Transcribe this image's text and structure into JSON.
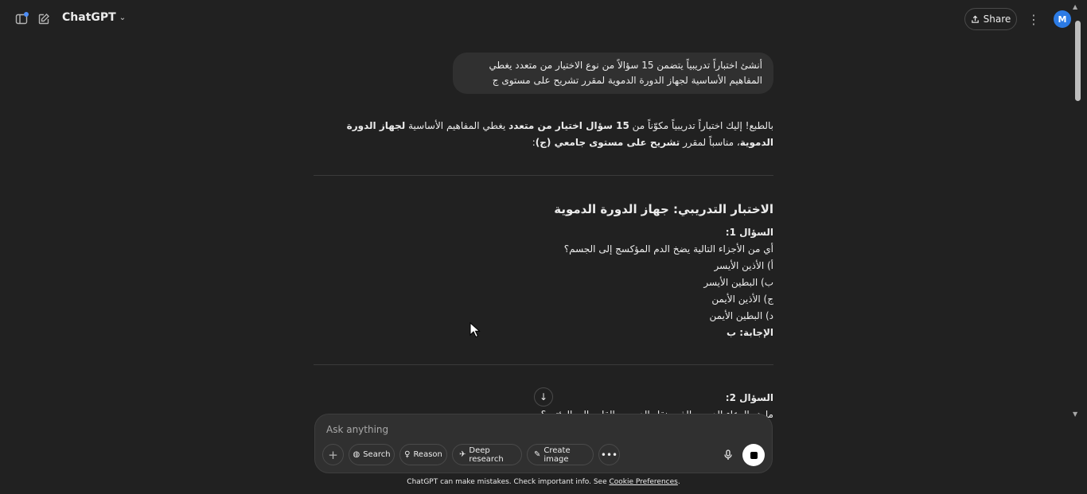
{
  "header": {
    "model_name": "ChatGPT",
    "share_label": "Share",
    "avatar_initial": "M",
    "accent_color": "#2c7be5"
  },
  "conversation": {
    "user_message": "أنشئ اختباراً تدريبياً يتضمن 15 سؤالاً من نوع الاختيار من متعدد يغطي المفاهيم الأساسية لجهاز الدورة الدموية لمقرر تشريح على مستوى ج",
    "assistant_intro": {
      "t1": "بالطبع! إليك اختباراً تدريبياً مكوّناً من ",
      "b1": "15 سؤال اختيار من متعدد",
      "t2": " يغطي المفاهيم الأساسية ",
      "b2": "لجهاز الدورة الدموية",
      "t3": "، مناسباً لمقرر ",
      "b3": "تشريح على مستوى جامعي (ج)",
      "t4": ":"
    },
    "quiz_title": "الاختبار التدريبي: جهاز الدورة الدموية",
    "questions": [
      {
        "label": "السؤال 1:",
        "text": "أي من الأجزاء التالية يضخ الدم المؤكسج إلى الجسم؟",
        "options": [
          "أ) الأذين الأيسر",
          "ب) البطين الأيسر",
          "ج) الأذين الأيمن",
          "د) البطين الأيمن"
        ],
        "answer": "الإجابة: ب"
      },
      {
        "label": "السؤال 2:",
        "text": "ما هو الوعاء الدموي الذي ينقل الدم من القلب إلى الرئتين؟"
      }
    ]
  },
  "composer": {
    "placeholder": "Ask anything",
    "tools": {
      "search": "Search",
      "reason": "Reason",
      "deep_research": "Deep research",
      "create_image": "Create image"
    }
  },
  "footer": {
    "disclaimer": "ChatGPT can make mistakes. Check important info. See ",
    "cookie_link": "Cookie Preferences",
    "period": "."
  }
}
